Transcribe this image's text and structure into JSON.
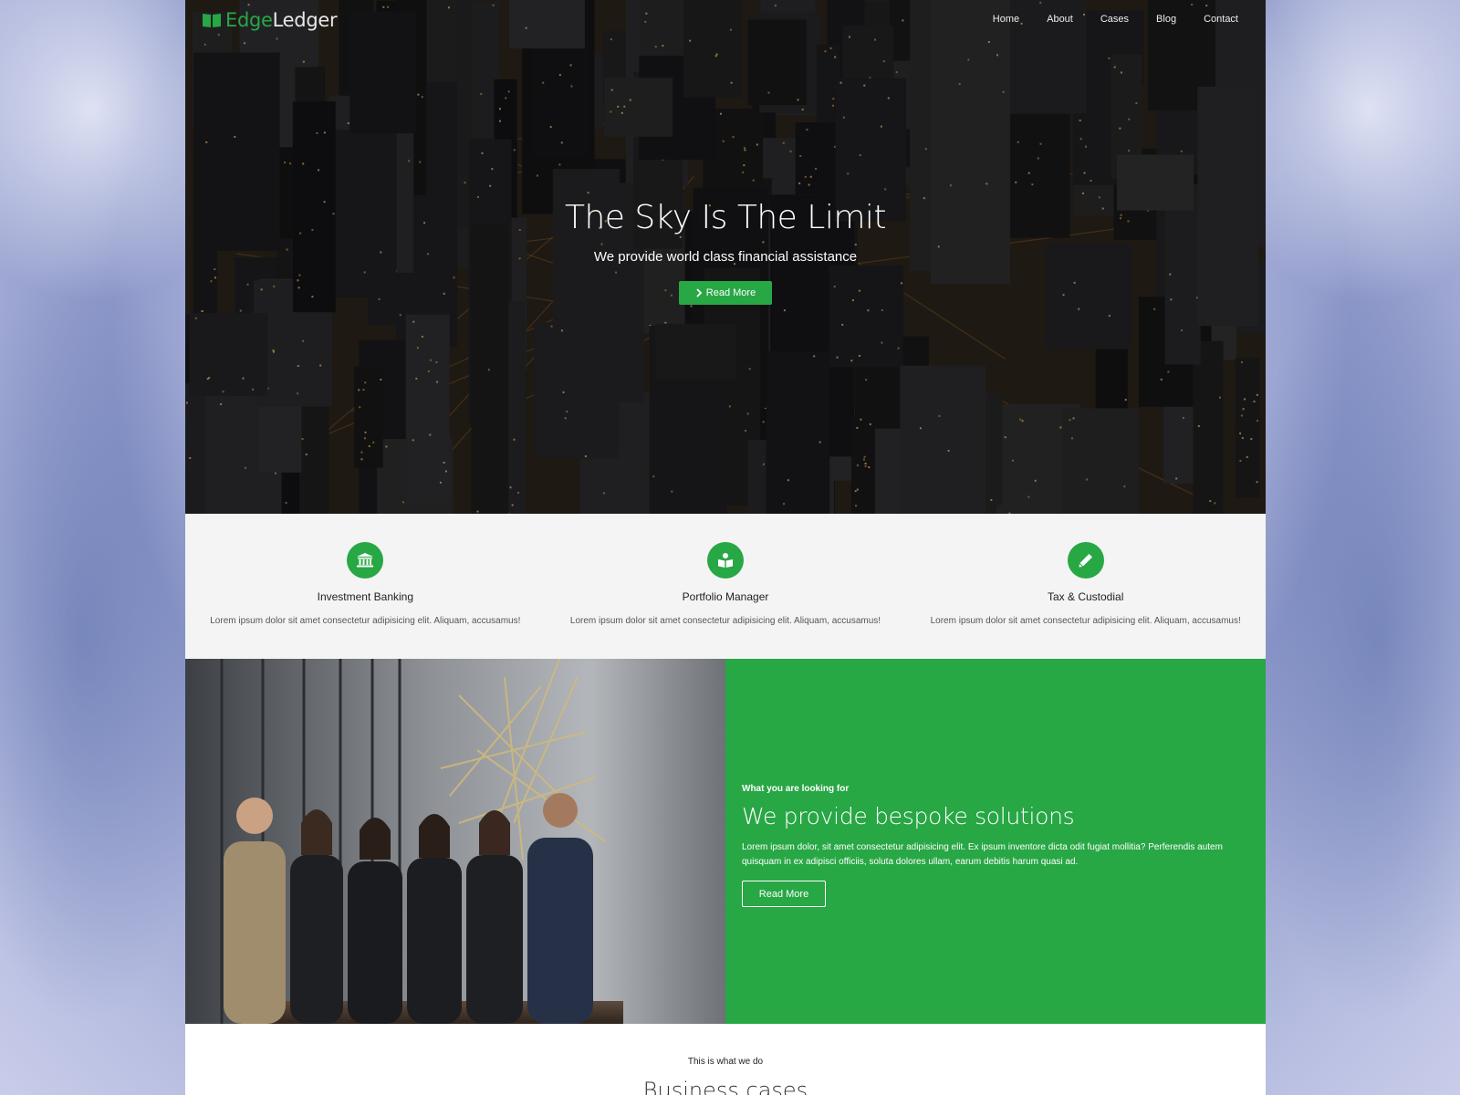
{
  "brand": {
    "part1": "Edge",
    "part2": "Ledger"
  },
  "nav": [
    "Home",
    "About",
    "Cases",
    "Blog",
    "Contact"
  ],
  "hero": {
    "title": "The Sky Is The Limit",
    "subtitle": "We provide world class financial assistance",
    "button": "Read More"
  },
  "features": [
    {
      "icon": "bank-icon",
      "title": "Investment Banking",
      "text": "Lorem ipsum dolor sit amet consectetur adipisicing elit. Aliquam, accusamus!"
    },
    {
      "icon": "book-reader-icon",
      "title": "Portfolio Manager",
      "text": "Lorem ipsum dolor sit amet consectetur adipisicing elit. Aliquam, accusamus!"
    },
    {
      "icon": "pencil-icon",
      "title": "Tax & Custodial",
      "text": "Lorem ipsum dolor sit amet consectetur adipisicing elit. Aliquam, accusamus!"
    }
  ],
  "solutions": {
    "kicker": "What you are looking for",
    "title": "We provide bespoke solutions",
    "text": "Lorem ipsum dolor, sit amet consectetur adipisicing elit. Ex ipsum inventore dicta odit fugiat mollitia? Perferendis autem quisquam in ex adipisci officiis, soluta dolores ullam, earum debitis harum quasi ad.",
    "button": "Read More"
  },
  "cases": {
    "kicker": "This is what we do",
    "title": "Business cases"
  },
  "colors": {
    "accent": "#28a745",
    "feature_bg": "#f4f4f4"
  }
}
